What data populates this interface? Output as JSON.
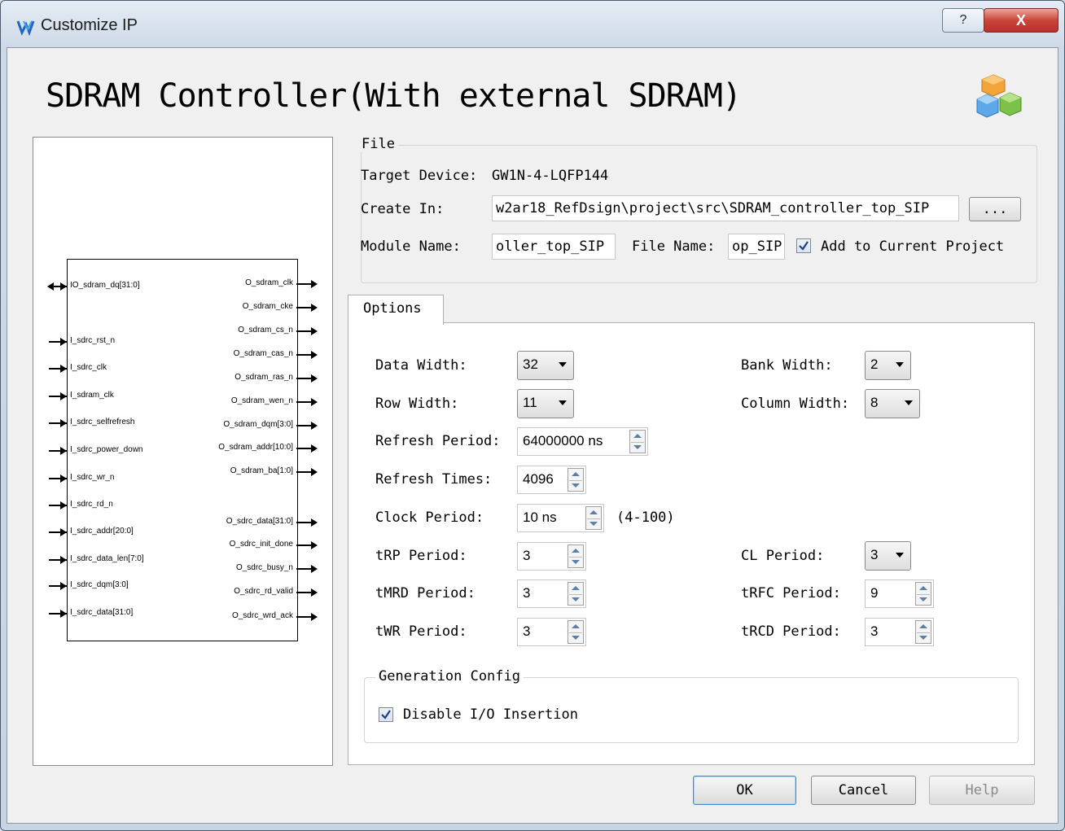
{
  "window": {
    "title": "Customize IP",
    "help_label": "?",
    "close_label": "X"
  },
  "heading": "SDRAM Controller(With external SDRAM)",
  "diagram": {
    "left_pins": [
      "IO_sdram_dq[31:0]",
      "I_sdrc_rst_n",
      "I_sdrc_clk",
      "I_sdram_clk",
      "I_sdrc_selfrefresh",
      "I_sdrc_power_down",
      "I_sdrc_wr_n",
      "I_sdrc_rd_n",
      "I_sdrc_addr[20:0]",
      "I_sdrc_data_len[7:0]",
      "I_sdrc_dqm[3:0]",
      "I_sdrc_data[31:0]"
    ],
    "right_pins": [
      "O_sdram_clk",
      "O_sdram_cke",
      "O_sdram_cs_n",
      "O_sdram_cas_n",
      "O_sdram_ras_n",
      "O_sdram_wen_n",
      "O_sdram_dqm[3:0]",
      "O_sdram_addr[10:0]",
      "O_sdram_ba[1:0]",
      "O_sdrc_data[31:0]",
      "O_sdrc_init_done",
      "O_sdrc_busy_n",
      "O_sdrc_rd_valid",
      "O_sdrc_wrd_ack"
    ]
  },
  "file": {
    "legend": "File",
    "target_device_label": "Target Device:",
    "target_device_value": "GW1N-4-LQFP144",
    "create_in_label": "Create In:",
    "create_in_value": "w2ar18_RefDsign\\project\\src\\SDRAM_controller_top_SIP",
    "browse_label": "...",
    "module_name_label": "Module Name:",
    "module_name_value": "oller_top_SIP",
    "file_name_label": "File Name:",
    "file_name_value": "op_SIP",
    "add_to_project_label": "Add to Current Project",
    "add_to_project_checked": true
  },
  "options": {
    "tab_label": "Options",
    "data_width_label": "Data Width:",
    "data_width_value": "32",
    "bank_width_label": "Bank Width:",
    "bank_width_value": "2",
    "row_width_label": "Row Width:",
    "row_width_value": "11",
    "column_width_label": "Column Width:",
    "column_width_value": "8",
    "refresh_period_label": "Refresh Period:",
    "refresh_period_value": "64000000 ns",
    "refresh_times_label": "Refresh Times:",
    "refresh_times_value": "4096",
    "clock_period_label": "Clock Period:",
    "clock_period_value": "10 ns",
    "clock_period_range": "(4-100)",
    "trp_label": "tRP Period:",
    "trp_value": "3",
    "cl_label": "CL Period:",
    "cl_value": "3",
    "tmrd_label": "tMRD Period:",
    "tmrd_value": "3",
    "trfc_label": "tRFC Period:",
    "trfc_value": "9",
    "twr_label": "tWR Period:",
    "twr_value": "3",
    "trcd_label": "tRCD Period:",
    "trcd_value": "3"
  },
  "generation": {
    "legend": "Generation Config",
    "disable_io_label": "Disable I/O Insertion",
    "disable_io_checked": true
  },
  "buttons": {
    "ok": "OK",
    "cancel": "Cancel",
    "help": "Help"
  }
}
